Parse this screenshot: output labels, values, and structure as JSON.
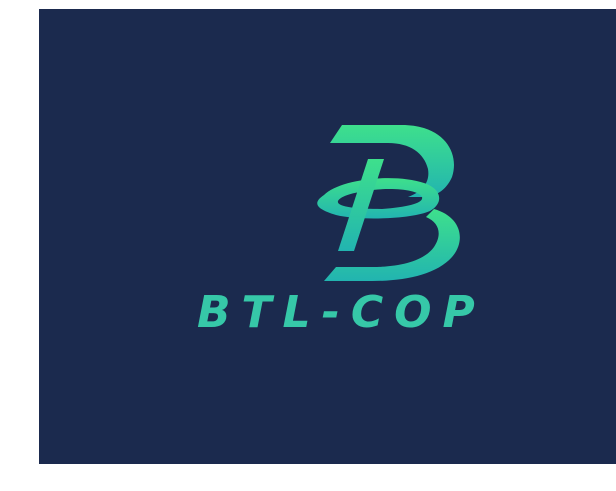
{
  "brand": {
    "name": "BTL-COP",
    "colors": {
      "background": "#1b2a4e",
      "accent_top": "#3ee08c",
      "accent_bottom": "#22b4b0",
      "text": "#36c8a8"
    },
    "mark_icon": "stylized-b-ring-icon"
  }
}
